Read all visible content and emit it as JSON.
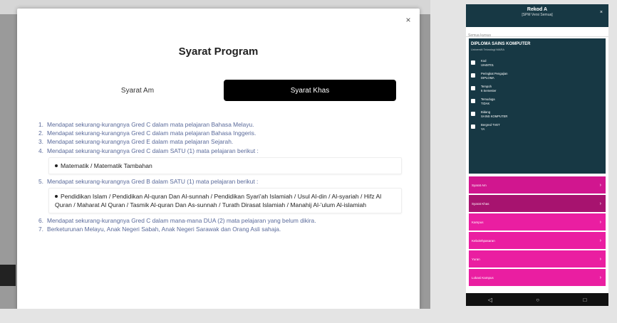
{
  "modal": {
    "close_label": "×",
    "title": "Syarat Program",
    "tabs": [
      {
        "label": "Syarat Am",
        "active": false
      },
      {
        "label": "Syarat Khas",
        "active": true
      }
    ],
    "requirements": [
      {
        "num": "1.",
        "text": "Mendapat sekurang-kurangnya Gred C dalam mata pelajaran Bahasa Melayu."
      },
      {
        "num": "2.",
        "text": "Mendapat sekurang-kurangnya Gred C dalam mata pelajaran Bahasa Inggeris."
      },
      {
        "num": "3.",
        "text": "Mendapat sekurang-kurangnya Gred E dalam mata pelajaran Sejarah."
      },
      {
        "num": "4.",
        "text": "Mendapat sekurang-kurangnya Gred C dalam SATU (1) mata pelajaran berikut :"
      },
      {
        "num": "5.",
        "text": "Mendapat sekurang-kurangnya Gred B dalam SATU (1) mata pelajaran berikut :"
      },
      {
        "num": "6.",
        "text": "Mendapat sekurang-kurangnya Gred C dalam mana-mana DUA (2) mata pelajaran yang belum dikira."
      },
      {
        "num": "7.",
        "text": "Berketurunan Melayu, Anak Negeri Sabah, Anak Negeri Sarawak dan Orang Asli sahaja."
      }
    ],
    "sub4": "Matematik / Matematik Tambahan",
    "sub5": "Pendidikan Islam / Pendidikan Al-quran Dan Al-sunnah / Pendidikan Syari'ah Islamiah / Usul Al-din / Al-syariah / Hifz Al Quran / Maharat Al Quran / Tasmik Al-quran Dan As-sunnah / Turath Dirasat Islamiah / Manahij Al-'ulum Al-islamiah"
  },
  "phone": {
    "header_title": "Rekod A",
    "header_sub": "[SPM Versi Semua]",
    "close": "×",
    "search_placeholder": "Semua kursus",
    "card_title": "DIPLOMA SAINS KOMPUTER",
    "card_sub": "Universiti Teknologi MARA",
    "items": [
      {
        "icon": "clock-icon",
        "text": "Kod\nUH48T01"
      },
      {
        "icon": "grad-icon",
        "text": "Peringkat Pengajian\nDIPLOMA"
      },
      {
        "icon": "calendar-icon",
        "text": "Tempoh\n6 Semester"
      },
      {
        "icon": "user-icon",
        "text": "Temuduga\nTIDAK"
      },
      {
        "icon": "book-icon",
        "text": "Bidang\nSAINS KOMPUTER"
      },
      {
        "icon": "doc-icon",
        "text": "Bergred TVET\nYA"
      }
    ],
    "menu": [
      {
        "label": "Syarat Am",
        "tone": "normal"
      },
      {
        "label": "Syarat Khas",
        "tone": "dark"
      },
      {
        "label": "Kampus",
        "tone": "light"
      },
      {
        "label": "Kebolehpasaran",
        "tone": "light"
      },
      {
        "label": "Yuran",
        "tone": "light"
      },
      {
        "label": "Lokasi Kampus",
        "tone": "light"
      }
    ],
    "nav": [
      "◁",
      "○",
      "□"
    ]
  }
}
